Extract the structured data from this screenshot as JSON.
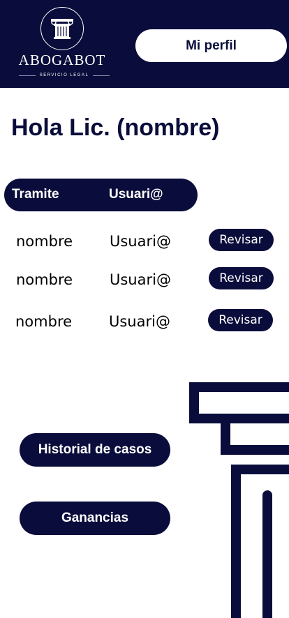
{
  "header": {
    "logo_name": "ABOGABOT",
    "logo_tagline": "SERVICIO LEGAL",
    "profile_label": "Mi perfil"
  },
  "greeting": "Hola Lic. (nombre)",
  "table": {
    "headers": [
      "Tramite",
      "Usuari@"
    ],
    "rows": [
      {
        "name": "nombre",
        "user": "Usuari@",
        "action": "Revisar"
      },
      {
        "name": "nombre",
        "user": "Usuari@",
        "action": "Revisar"
      },
      {
        "name": "nombre",
        "user": "Usuari@",
        "action": "Revisar"
      }
    ]
  },
  "buttons": {
    "history": "Historial de casos",
    "earnings": "Ganancias"
  },
  "icons": [
    "column-logo-icon",
    "column-decoration-icon"
  ],
  "colors": {
    "primary": "#0a0d3b",
    "background": "#ffffff"
  }
}
